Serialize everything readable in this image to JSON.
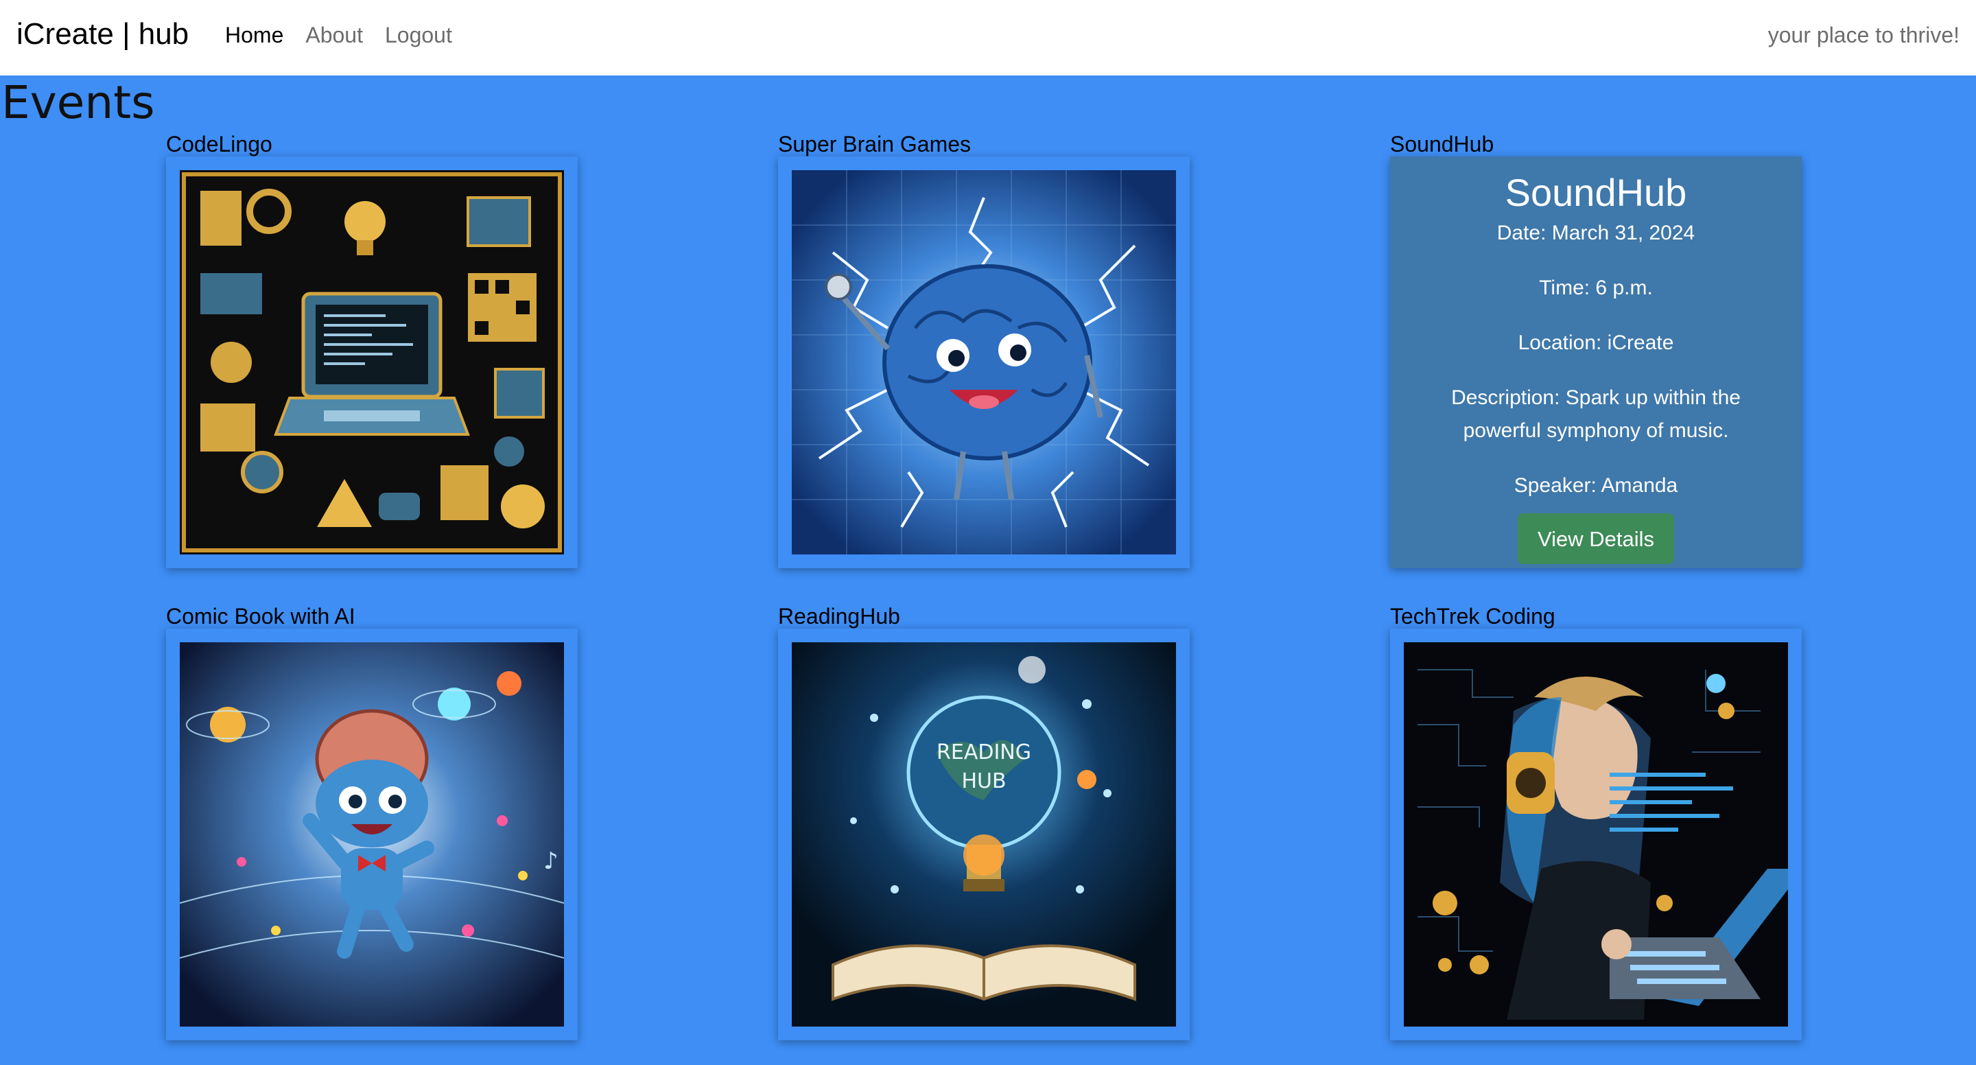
{
  "navbar": {
    "brand": "iCreate | hub",
    "links": [
      "Home",
      "About",
      "Logout"
    ],
    "tagline": "your place to thrive!"
  },
  "page": {
    "title": "Events"
  },
  "events": [
    {
      "title": "CodeLingo"
    },
    {
      "title": "Super Brain Games"
    },
    {
      "title": "SoundHub"
    },
    {
      "title": "Comic Book with AI"
    },
    {
      "title": "ReadingHub"
    },
    {
      "title": "TechTrek Coding"
    }
  ],
  "details": {
    "title": "SoundHub",
    "date": "Date: March 31, 2024",
    "time": "Time: 6 p.m.",
    "location": "Location: iCreate",
    "description": "Description: Spark up within the powerful symphony of music.",
    "speaker": "Speaker: Amanda",
    "button": "View Details"
  },
  "reading_image_text": [
    "READING",
    "HUB"
  ],
  "colors": {
    "background": "#3e8ef5",
    "details_card": "#3f78aa",
    "button": "#3d8b57"
  }
}
